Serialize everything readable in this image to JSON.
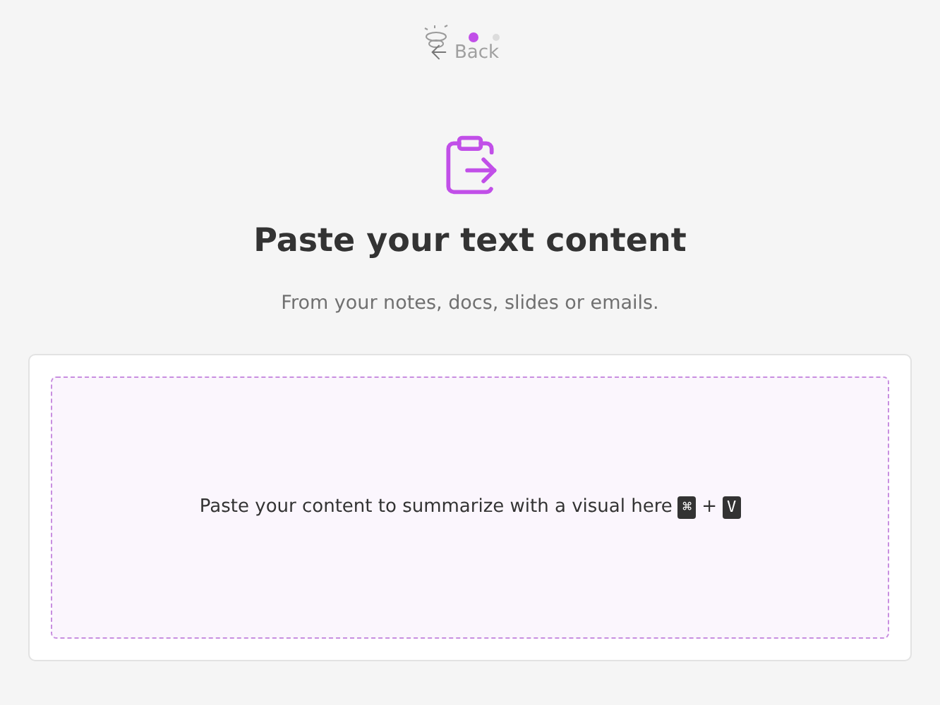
{
  "back": {
    "label": "Back"
  },
  "steps": [
    {
      "selected": true
    },
    {
      "selected": false
    }
  ],
  "title": "Paste your text content",
  "subtitle": "From your notes, docs, slides or emails.",
  "dropzone": {
    "text": "Paste your content to summarize with a visual here",
    "keys": [
      "⌘",
      "V"
    ],
    "joiner": "+"
  }
}
